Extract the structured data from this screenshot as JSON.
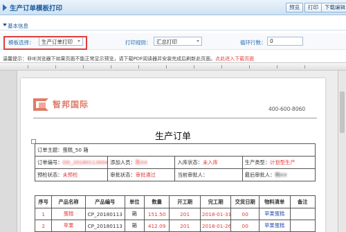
{
  "titlebar": {
    "title": "生产订单模板打印",
    "btn_preview": "预览",
    "btn_print": "打印",
    "btn_download": "下载编辑"
  },
  "section": {
    "title": "基本信息"
  },
  "form": {
    "template_label": "模板选择：",
    "template_value": "生产订单打印",
    "rule_label": "打印规则：",
    "rule_value": "汇总打印",
    "loop_label": "循环行数：",
    "loop_value": "0"
  },
  "hint": {
    "text": "温馨提示：非IE浏览器下如果页面不能正常显示预览，请下载PDF阅读器并安装完成后刷新此页面。",
    "link": "点此进入下载页面"
  },
  "document": {
    "logo_text": "智邦国际",
    "phone": "400-600-8060",
    "title": "生产订单",
    "subject_label": "订单主题：",
    "subject_value": "蛋糕_50 箱",
    "order_no_label": "订单编号：",
    "order_no_value": "DD_20180113004",
    "adder_label": "添加人员：",
    "adder_value": "陈XX",
    "instock_label": "入库状态：",
    "instock_value": "未入库",
    "ptype_label": "生产类型：",
    "ptype_value": "计划型生产",
    "prestatus_label": "预检状态：",
    "prestatus_value": "未预检",
    "approve_label": "审批状态：",
    "approve_value": "审批通过",
    "cur_approver_label": "当前审批人：",
    "cur_approver_value": "",
    "last_approver_label": "最后审批人：",
    "last_approver_value": "韩XX"
  },
  "products": {
    "headers": [
      "序号",
      "产品名称",
      "产品编号",
      "单位",
      "数量",
      "开工期",
      "完工期",
      "交货日期",
      "物料清单",
      "备注"
    ],
    "rows": [
      [
        "1",
        "蛋糕",
        "CP_20180113",
        "箱",
        "151.50",
        "201",
        "2018-01-31",
        "00",
        "苹果蛋糕",
        ""
      ],
      [
        "2",
        "苹果",
        "CP_20180113",
        "箱",
        "412.09",
        "201",
        "2018-01-26",
        "00",
        "苹果蛋糕",
        ""
      ]
    ]
  }
}
